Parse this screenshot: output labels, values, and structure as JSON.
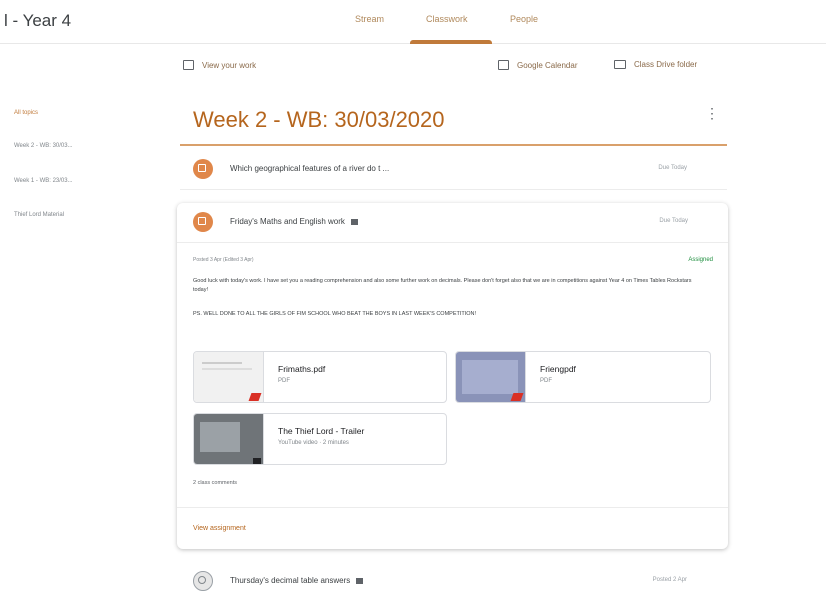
{
  "header": {
    "class_title": "l - Year 4",
    "tabs": [
      {
        "label": "Stream"
      },
      {
        "label": "Classwork"
      },
      {
        "label": "People"
      }
    ]
  },
  "toolbar": {
    "view_work": "View your work",
    "calendar": "Google Calendar",
    "drive": "Class Drive folder"
  },
  "sidebar": {
    "items": [
      {
        "label": "All topics"
      },
      {
        "label": "Week 2 - WB: 30/03..."
      },
      {
        "label": "Week 1 - WB: 23/03..."
      },
      {
        "label": "Thief Lord Material"
      }
    ]
  },
  "topic": {
    "title": "Week 2 - WB: 30/03/2020"
  },
  "rows": {
    "r1": {
      "title": "Which geographical features of a river do t ...",
      "date": "Due Today"
    },
    "r3": {
      "title": "Thursday's decimal table answers",
      "date": "Posted 2 Apr"
    }
  },
  "card": {
    "title": "Friday's Maths and English work",
    "due": "Due Today",
    "posted": "Posted 3 Apr (Edited 3 Apr)",
    "status": "Assigned",
    "description": "Good luck with today's work. I have set you a reading comprehension and also some further work on decimals. Please don't forget also that we are in competitions against Year 4 on Times Tables Rockstars today!",
    "ps": "PS. WELL DONE TO ALL THE GIRLS OF FIM SCHOOL WHO BEAT THE BOYS IN LAST WEEK'S COMPETITION!",
    "attachments": [
      {
        "title": "Frimaths.pdf",
        "sub": "PDF"
      },
      {
        "title": "Friengpdf",
        "sub": "PDF"
      },
      {
        "title": "The Thief Lord - Trailer",
        "sub": "YouTube video · 2 minutes"
      }
    ],
    "comments": "2 class comments",
    "view_link": "View assignment"
  }
}
